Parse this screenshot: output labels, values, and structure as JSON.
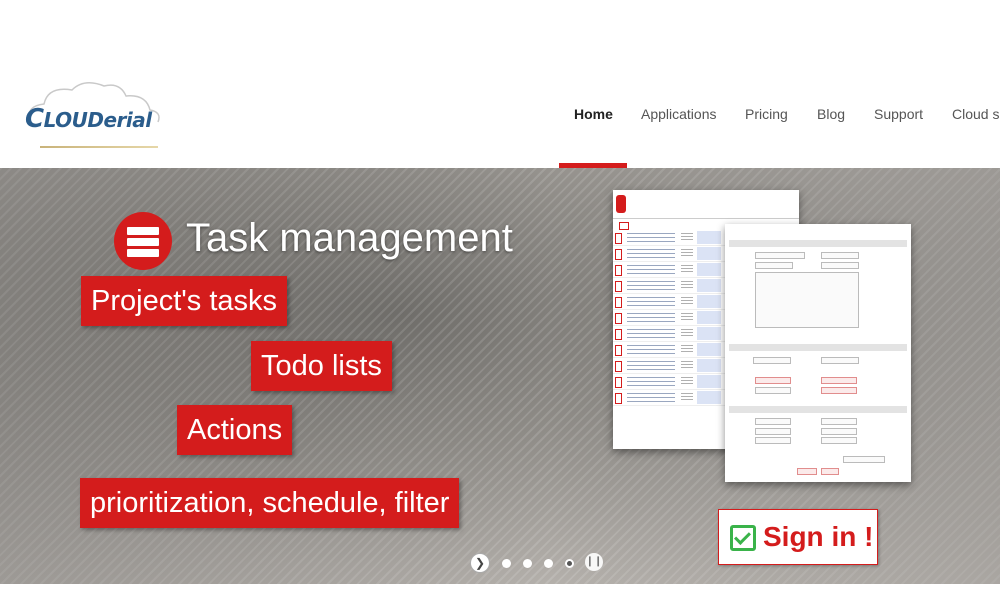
{
  "logo": {
    "prefix_big": "C",
    "main": "LOUD",
    "suffix": "erial"
  },
  "nav": {
    "items": [
      {
        "label": "Home",
        "active": true
      },
      {
        "label": "Applications",
        "active": false
      },
      {
        "label": "Pricing",
        "active": false
      },
      {
        "label": "Blog",
        "active": false
      },
      {
        "label": "Support",
        "active": false
      },
      {
        "label": "Cloud se",
        "active": false
      }
    ]
  },
  "hero": {
    "title": "Task management",
    "tags": [
      "Project's tasks",
      "Todo lists",
      "Actions",
      "prioritization, schedule, filter"
    ],
    "signin_label": "Sign in !",
    "slider": {
      "slides": 4,
      "active_index": 3,
      "prev_icon": "chevron-right-icon",
      "pause_icon": "pause-icon"
    }
  },
  "colors": {
    "accent": "#d41c1c",
    "check": "#3ab34a",
    "nav_text": "#555555"
  }
}
